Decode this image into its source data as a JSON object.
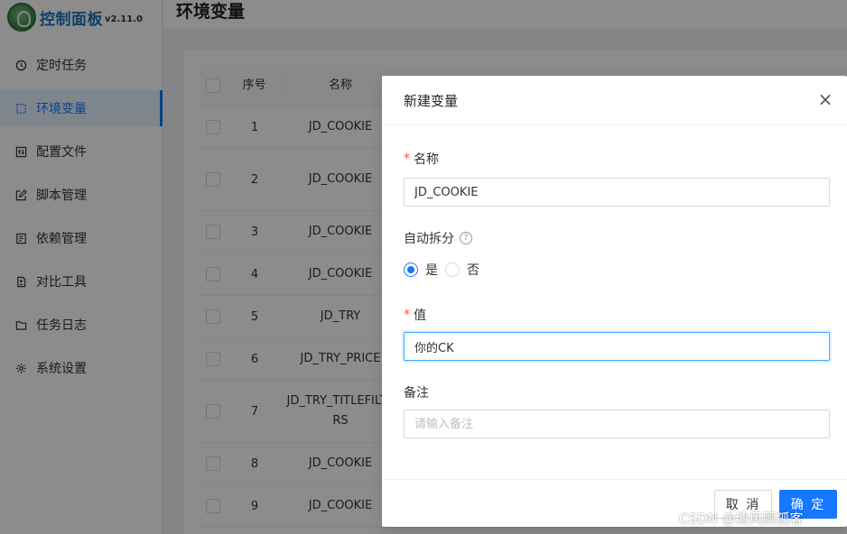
{
  "app": {
    "title": "控制面板",
    "version": "v2.11.0"
  },
  "sidebar": {
    "items": [
      {
        "label": "定时任务",
        "icon": "clock-icon"
      },
      {
        "label": "环境变量",
        "icon": "env-icon",
        "active": true
      },
      {
        "label": "配置文件",
        "icon": "config-icon"
      },
      {
        "label": "脚本管理",
        "icon": "edit-icon"
      },
      {
        "label": "依赖管理",
        "icon": "package-icon"
      },
      {
        "label": "对比工具",
        "icon": "diff-icon"
      },
      {
        "label": "任务日志",
        "icon": "folder-icon"
      },
      {
        "label": "系统设置",
        "icon": "gear-icon"
      }
    ]
  },
  "header": {
    "title": "环境变量"
  },
  "table": {
    "columns": [
      "序号",
      "名称"
    ],
    "rows": [
      {
        "no": "1",
        "name": "JD_COOKIE"
      },
      {
        "no": "2",
        "name": "JD_COOKIE"
      },
      {
        "no": "3",
        "name": "JD_COOKIE"
      },
      {
        "no": "4",
        "name": "JD_COOKIE"
      },
      {
        "no": "5",
        "name": "JD_TRY"
      },
      {
        "no": "6",
        "name": "JD_TRY_PRICE"
      },
      {
        "no": "7",
        "name": "JD_TRY_TITLEFILTERS"
      },
      {
        "no": "8",
        "name": "JD_COOKIE"
      },
      {
        "no": "9",
        "name": "JD_COOKIE"
      }
    ]
  },
  "modal": {
    "title": "新建变量",
    "close": "×",
    "required_mark": "*",
    "name_label": "名称",
    "name_value": "JD_COOKIE",
    "split_label": "自动拆分",
    "help": "?",
    "radio_yes": "是",
    "radio_no": "否",
    "value_label": "值",
    "value_value": "你的CK",
    "remark_label": "备注",
    "remark_placeholder": "请输入备注",
    "cancel": "取 消",
    "ok": "确 定"
  },
  "watermark": "CSDN @清风顾孤客"
}
